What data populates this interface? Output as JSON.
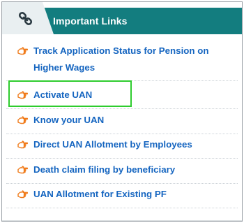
{
  "panel": {
    "title": "Important Links",
    "header_icon": "chain-link-icon"
  },
  "colors": {
    "header_bg": "#137d7f",
    "tab_bg": "#e9eff1",
    "link_text": "#1565c0",
    "hand_icon": "#f07b1a",
    "highlight_border": "#2ecc2e"
  },
  "links": [
    {
      "label_line1": "Track Application Status for Pension on",
      "label_line2": "Higher Wages",
      "icon": "pointing-hand-icon"
    },
    {
      "label": "Activate UAN",
      "icon": "pointing-hand-icon",
      "highlighted": true
    },
    {
      "label": "Know your UAN",
      "icon": "pointing-hand-icon"
    },
    {
      "label": "Direct UAN Allotment by Employees",
      "icon": "pointing-hand-icon"
    },
    {
      "label": "Death claim filing by beneficiary",
      "icon": "pointing-hand-icon"
    },
    {
      "label": "UAN Allotment for Existing PF",
      "icon": "pointing-hand-icon"
    }
  ]
}
